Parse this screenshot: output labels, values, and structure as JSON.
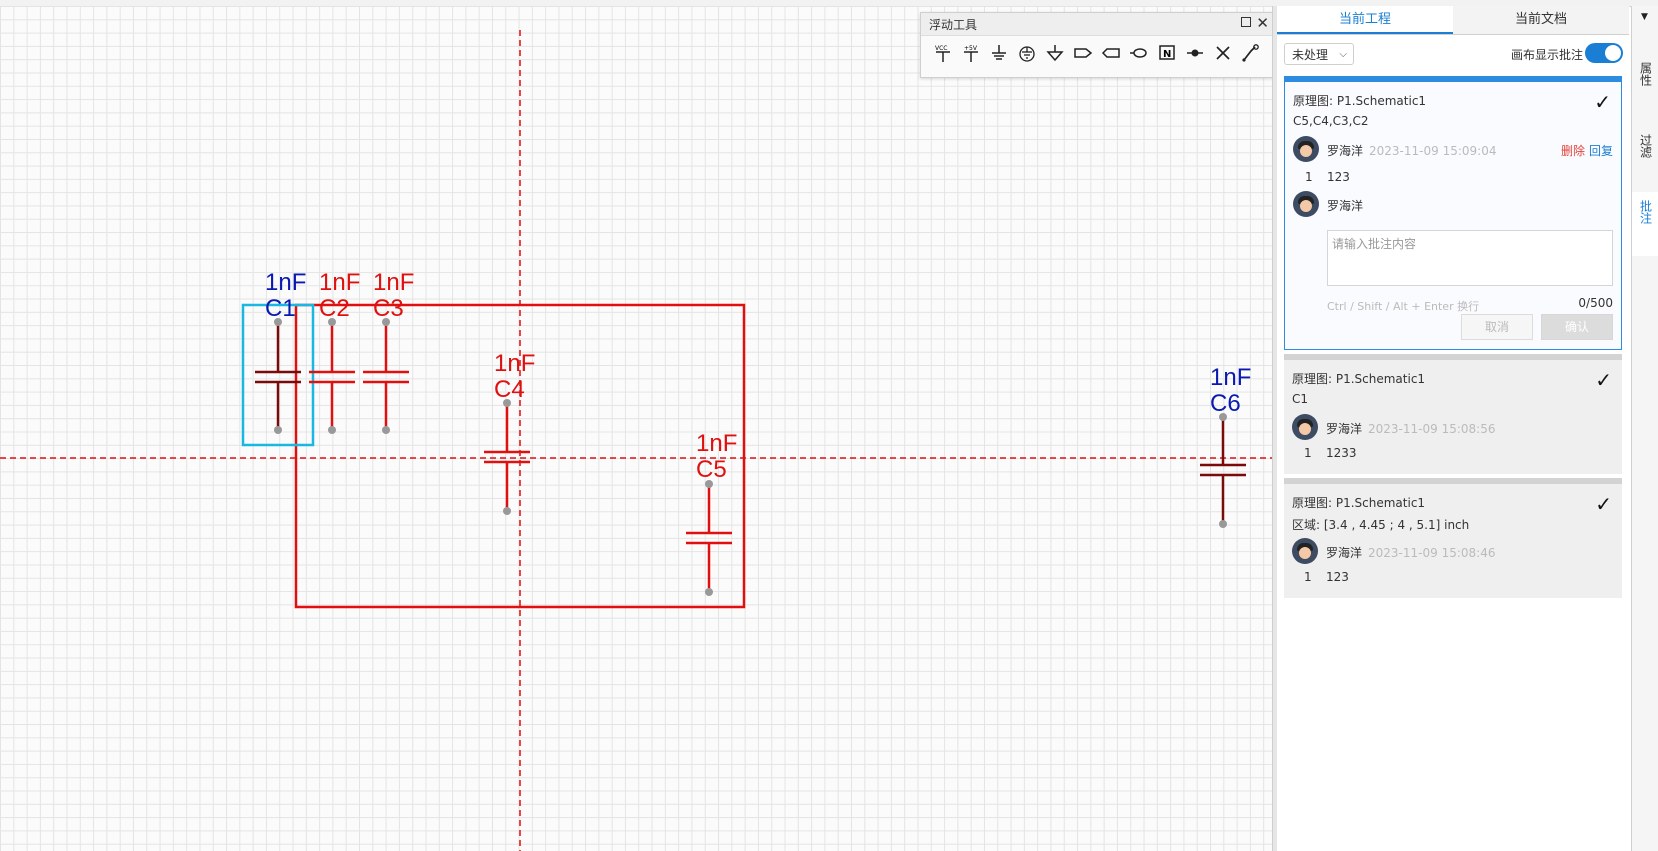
{
  "float_tool": {
    "title": "浮动工具",
    "icons": [
      "vcc-icon",
      "plus5v-icon",
      "ground-icon",
      "earth-ground-icon",
      "signal-ground-icon",
      "net-port-icon",
      "net-flag-icon",
      "net-label-oval-icon",
      "no-connect-flag-icon",
      "junction-icon",
      "no-connect-cross-icon",
      "wire-tool-icon"
    ],
    "glyphs": [
      "⏚",
      "⏚",
      "⏚",
      "⏚",
      "⏚",
      "▷",
      "⊏",
      "○",
      "N",
      "⊸",
      "✕",
      "⟋"
    ]
  },
  "schematic": {
    "components": [
      {
        "ref": "C1",
        "value": "1nF",
        "color": "#0a1ab0"
      },
      {
        "ref": "C2",
        "value": "1nF",
        "color": "#e01010"
      },
      {
        "ref": "C3",
        "value": "1nF",
        "color": "#e01010"
      },
      {
        "ref": "C4",
        "value": "1nF",
        "color": "#e01010"
      },
      {
        "ref": "C5",
        "value": "1nF",
        "color": "#e01010"
      },
      {
        "ref": "C6",
        "value": "1nF",
        "color": "#0a1ab0"
      }
    ]
  },
  "panel": {
    "tabs": [
      "当前工程",
      "当前文档"
    ],
    "filter": "未处理",
    "show_label": "画布显示批注",
    "comments": [
      {
        "title": "原理图: P1.Schematic1",
        "refs": "C5,C4,C3,C2",
        "author": "罗海洋",
        "time": "2023-11-09 15:09:04",
        "delete": "删除",
        "reply": "回复",
        "index": "1",
        "text": "123",
        "reply_author": "罗海洋",
        "placeholder": "请输入批注内容",
        "hint": "Ctrl / Shift / Alt + Enter 换行",
        "count": "0/500",
        "cancel": "取消",
        "confirm": "确认"
      },
      {
        "title": "原理图: P1.Schematic1",
        "refs": "C1",
        "author": "罗海洋",
        "time": "2023-11-09 15:08:56",
        "index": "1",
        "text": "1233"
      },
      {
        "title": "原理图: P1.Schematic1",
        "refs": "区域: [3.4 , 4.45 ; 4 , 5.1] inch",
        "author": "罗海洋",
        "time": "2023-11-09 15:08:46",
        "index": "1",
        "text": "123"
      }
    ]
  },
  "sidetabs": [
    "属性",
    "过滤",
    "批注"
  ],
  "colors": {
    "accent": "#1a7fd4",
    "component_red": "#e01010",
    "component_blue": "#0a1ab0",
    "selection": "#1ab8e0"
  }
}
